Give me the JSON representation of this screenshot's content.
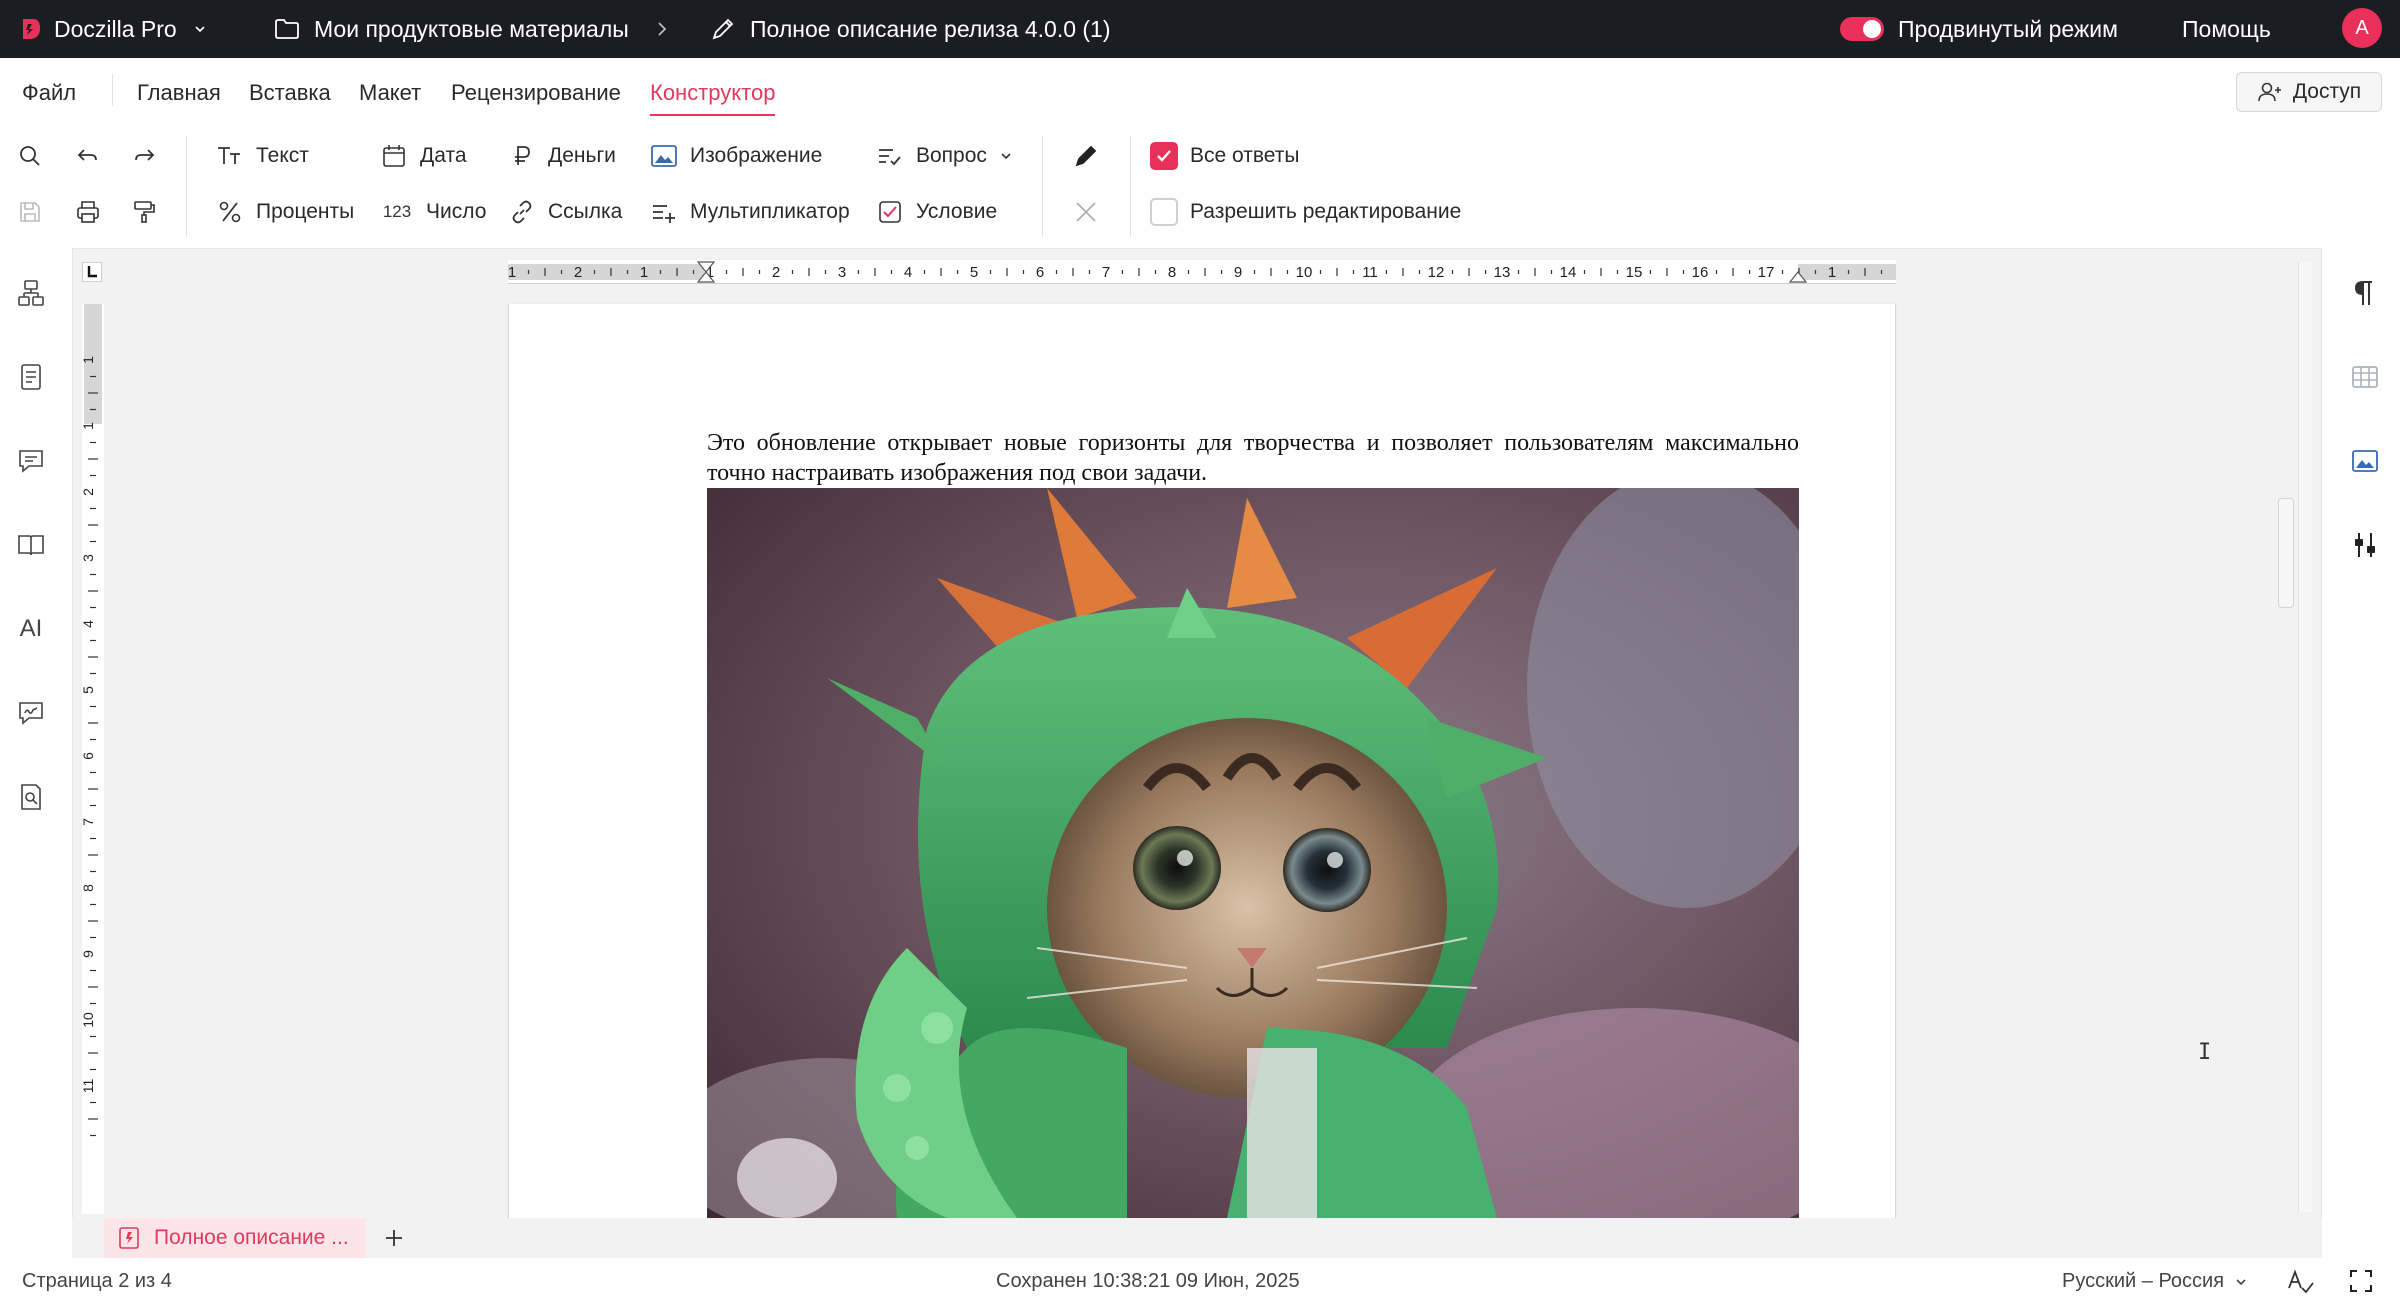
{
  "app": {
    "name": "Doczilla Pro",
    "brand_color": "#e8305a",
    "breadcrumb_folder": "Мои продуктовые материалы",
    "document_title": "Полное описание релиза 4.0.0 (1)",
    "advanced_mode_label": "Продвинутый режим",
    "advanced_mode_on": true,
    "help_label": "Помощь",
    "avatar_letter": "A"
  },
  "menu": {
    "file": "Файл",
    "tabs": [
      "Главная",
      "Вставка",
      "Макет",
      "Рецензирование",
      "Конструктор"
    ],
    "active_tab": "Конструктор",
    "share_label": "Доступ"
  },
  "toolbar": {
    "text": "Текст",
    "date": "Дата",
    "money": "Деньги",
    "image": "Изображение",
    "question": "Вопрос",
    "percent": "Проценты",
    "number_prefix": "123",
    "number": "Число",
    "link": "Ссылка",
    "multiplier": "Мультипликатор",
    "condition": "Условие",
    "all_answers": "Все ответы",
    "all_answers_checked": true,
    "allow_editing": "Разрешить редактирование",
    "allow_editing_checked": false
  },
  "ruler": {
    "h_labels": [
      "1",
      "2",
      "1",
      "1",
      "2",
      "3",
      "4",
      "5",
      "6",
      "7",
      "8",
      "9",
      "10",
      "11",
      "12",
      "13",
      "14",
      "15",
      "16",
      "17",
      "1"
    ],
    "v_labels": [
      "1",
      "1",
      "2",
      "3",
      "4",
      "5",
      "6",
      "7",
      "8",
      "9",
      "10",
      "11"
    ]
  },
  "document": {
    "paragraph": "Это обновление открывает новые горизонты для творчества и позволяет пользователям максимально точно настраивать изображения под свои задачи.",
    "image_description": "kitten-in-green-dinosaur-costume"
  },
  "tabs_bar": {
    "doc_tab_label": "Полное описание ..."
  },
  "status": {
    "page": "Страница 2 из 4",
    "saved": "Сохранен 10:38:21 09 Июн, 2025",
    "language": "Русский – Россия"
  }
}
